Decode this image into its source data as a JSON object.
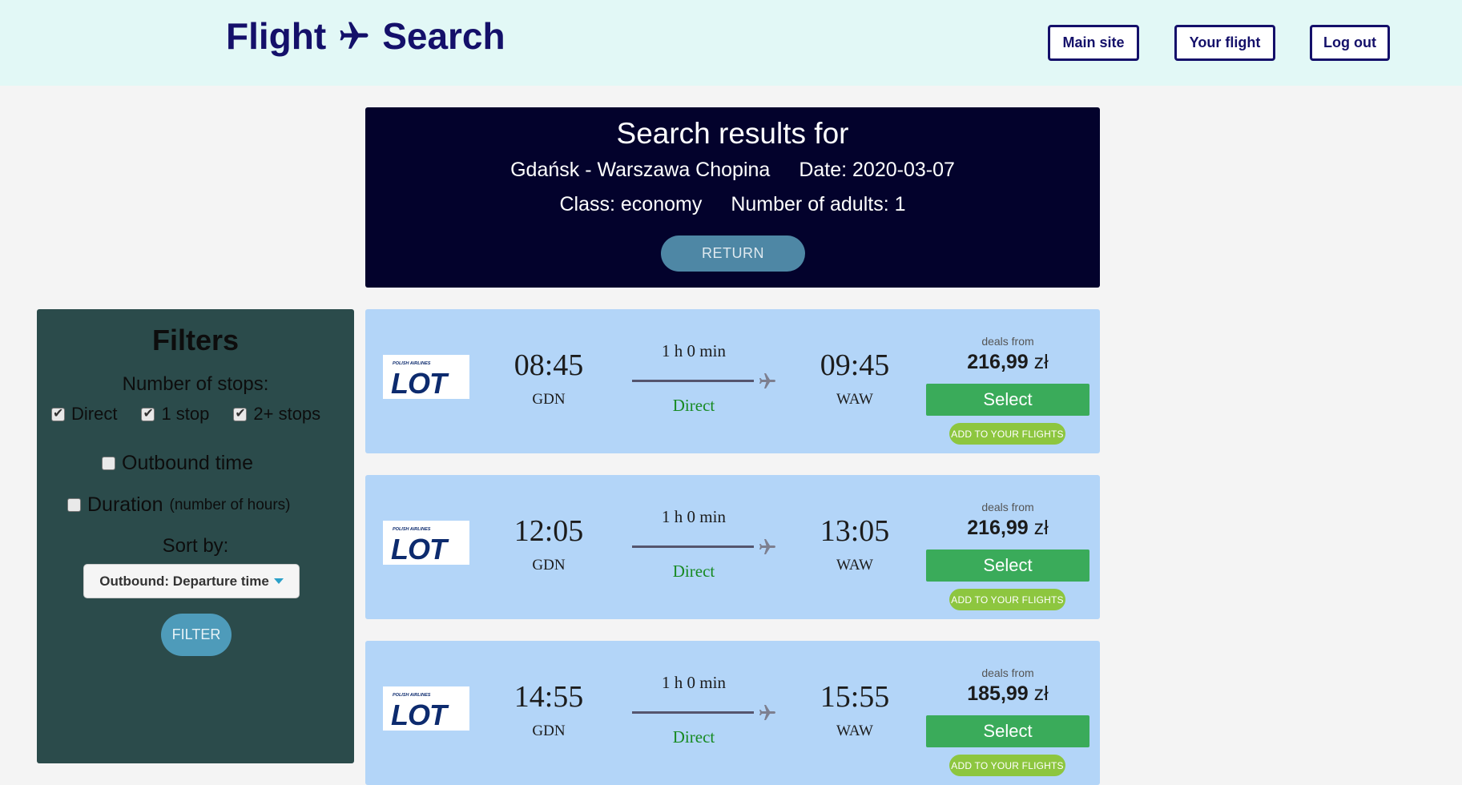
{
  "header": {
    "brand_left": "Flight",
    "brand_right": "Search",
    "brand_icon": "airplane-icon",
    "nav": [
      {
        "label": "Main site"
      },
      {
        "label": "Your flight"
      },
      {
        "label": "Log out"
      }
    ]
  },
  "search": {
    "title": "Search results for",
    "route": "Gdańsk - Warszawa Chopina",
    "date": "Date: 2020-03-07",
    "class": "Class: economy",
    "adults": "Number of adults: 1",
    "return_label": "RETURN"
  },
  "filters": {
    "title": "Filters",
    "stops_label": "Number of stops:",
    "stops": [
      {
        "label": "Direct",
        "checked": true
      },
      {
        "label": "1 stop",
        "checked": true
      },
      {
        "label": "2+ stops",
        "checked": true
      }
    ],
    "outbound_time": "Outbound time",
    "duration": "Duration",
    "duration_note": "(number of hours)",
    "sort_label": "Sort by:",
    "sort_value": "Outbound: Departure time",
    "filter_label": "FILTER"
  },
  "colors": {
    "brand": "#14106a",
    "select": "#3aab5a",
    "add": "#8dc63f",
    "direct": "#178a22"
  },
  "flights": [
    {
      "airline_logo_text": "LOT",
      "airline_subtitle": "POLISH AIRLINES",
      "dep_time": "08:45",
      "dep_code": "GDN",
      "duration": "1 h 0 min",
      "stops": "Direct",
      "arr_time": "09:45",
      "arr_code": "WAW",
      "deals_label": "deals from",
      "price": "216,99",
      "currency": "zł",
      "select_label": "Select",
      "add_label": "ADD TO YOUR FLIGHTS"
    },
    {
      "airline_logo_text": "LOT",
      "airline_subtitle": "POLISH AIRLINES",
      "dep_time": "12:05",
      "dep_code": "GDN",
      "duration": "1 h 0 min",
      "stops": "Direct",
      "arr_time": "13:05",
      "arr_code": "WAW",
      "deals_label": "deals from",
      "price": "216,99",
      "currency": "zł",
      "select_label": "Select",
      "add_label": "ADD TO YOUR FLIGHTS"
    },
    {
      "airline_logo_text": "LOT",
      "airline_subtitle": "POLISH AIRLINES",
      "dep_time": "14:55",
      "dep_code": "GDN",
      "duration": "1 h 0 min",
      "stops": "Direct",
      "arr_time": "15:55",
      "arr_code": "WAW",
      "deals_label": "deals from",
      "price": "185,99",
      "currency": "zł",
      "select_label": "Select",
      "add_label": "ADD TO YOUR FLIGHTS"
    }
  ]
}
